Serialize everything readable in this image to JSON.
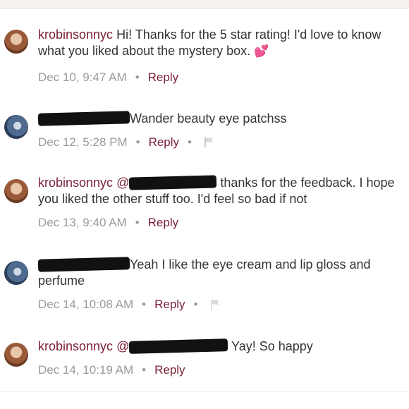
{
  "comments": [
    {
      "username": "krobinsonnyc",
      "text": "Hi! Thanks for the 5 star rating! I'd love to know what you liked about the mystery box.",
      "time": "Dec 10, 9:47 AM",
      "reply": "Reply"
    },
    {
      "text": "Wander beauty eye patchss",
      "time": "Dec 12, 5:28 PM",
      "reply": "Reply"
    },
    {
      "username": "krobinsonnyc",
      "mention": "@",
      "text": "thanks for the feedback. I hope you liked the other stuff too. I'd feel so bad if not",
      "time": "Dec 13, 9:40 AM",
      "reply": "Reply"
    },
    {
      "text": "Yeah I like the eye cream and lip gloss and perfume",
      "time": "Dec 14, 10:08 AM",
      "reply": "Reply"
    },
    {
      "username": "krobinsonnyc",
      "mention": "@",
      "text": "Yay! So happy",
      "time": "Dec 14, 10:19 AM",
      "reply": "Reply"
    }
  ],
  "separator": "•",
  "icons": {
    "heart": "heart-icon",
    "flag": "flag-icon"
  },
  "colors": {
    "username": "#7a1f36",
    "reply": "#7a1f36",
    "meta": "#9a9a9a",
    "text": "#333333"
  }
}
